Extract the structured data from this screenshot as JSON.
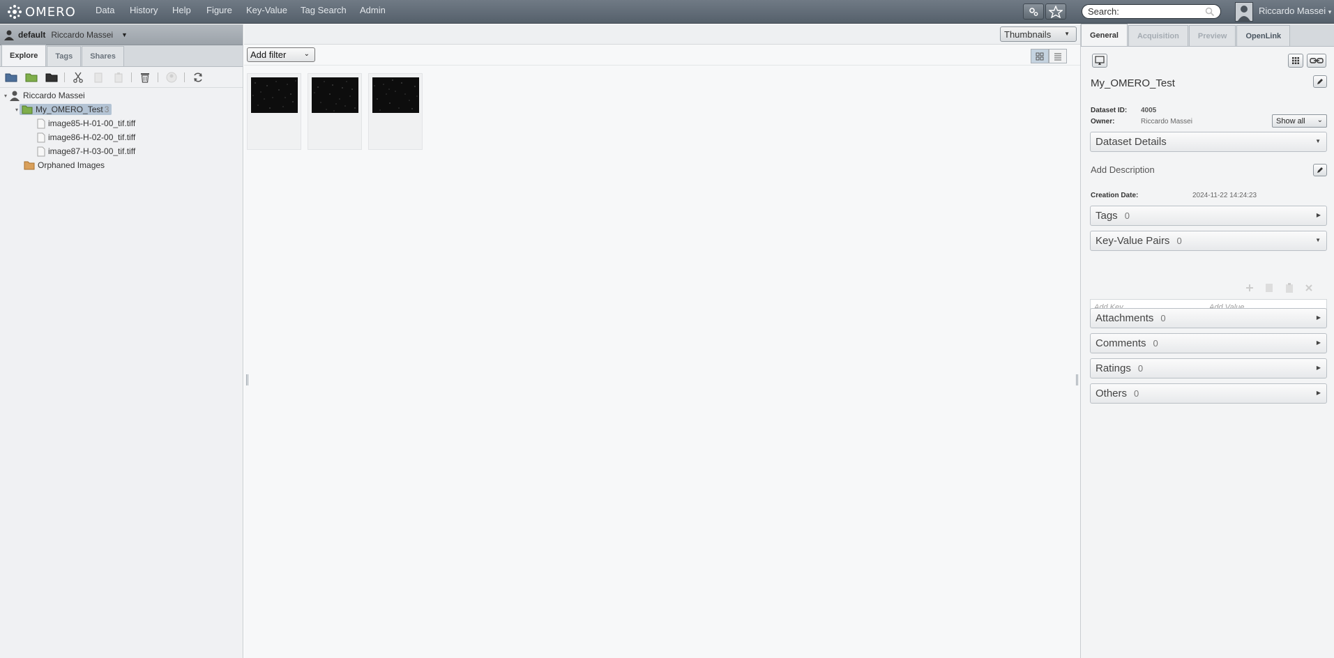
{
  "app": {
    "logo_text": "OMERO"
  },
  "topnav": [
    "Data",
    "History",
    "Help",
    "Figure",
    "Key-Value",
    "Tag Search",
    "Admin"
  ],
  "search": {
    "placeholder": "Search:"
  },
  "user": {
    "name": "Riccardo Massei"
  },
  "group_bar": {
    "group": "default",
    "user": "Riccardo Massei"
  },
  "left_tabs": [
    "Explore",
    "Tags",
    "Shares"
  ],
  "tree": {
    "root_user": "Riccardo Massei",
    "dataset_name": "My_OMERO_Test",
    "dataset_count": "3",
    "images": [
      "image85-H-01-00_tif.tiff",
      "image86-H-02-00_tif.tiff",
      "image87-H-03-00_tif.tiff"
    ],
    "orphaned": "Orphaned Images"
  },
  "center": {
    "view_mode": "Thumbnails",
    "add_filter": "Add filter"
  },
  "right_tabs": [
    "General",
    "Acquisition",
    "Preview",
    "OpenLink"
  ],
  "details": {
    "title": "My_OMERO_Test",
    "dataset_id_label": "Dataset ID:",
    "dataset_id": "4005",
    "owner_label": "Owner:",
    "owner": "Riccardo Massei",
    "show_all": "Show all",
    "dataset_details": "Dataset Details",
    "add_description": "Add Description",
    "creation_date_label": "Creation Date:",
    "creation_date": "2024-11-22 14:24:23",
    "tags_label": "Tags",
    "tags_count": "0",
    "kv_label": "Key-Value Pairs",
    "kv_count": "0",
    "kv_key_placeholder": "Add Key",
    "kv_value_placeholder": "Add Value",
    "attachments_label": "Attachments",
    "attachments_count": "0",
    "comments_label": "Comments",
    "comments_count": "0",
    "ratings_label": "Ratings",
    "ratings_count": "0",
    "others_label": "Others",
    "others_count": "0"
  }
}
